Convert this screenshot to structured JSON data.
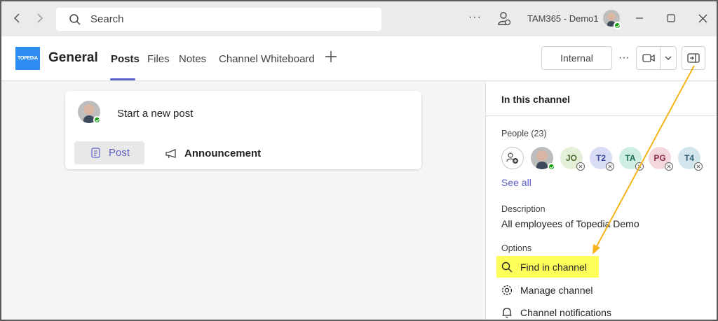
{
  "titlebar": {
    "search_placeholder": "Search",
    "more": "···",
    "account_name": "TAM365 - Demo1"
  },
  "header": {
    "logo_text": "TOPEDIA",
    "channel_name": "General",
    "tabs": [
      {
        "label": "Posts",
        "active": true
      },
      {
        "label": "Files"
      },
      {
        "label": "Notes"
      },
      {
        "label": "Channel Whiteboard"
      }
    ],
    "internal_label": "Internal",
    "more": "···"
  },
  "compose": {
    "prompt": "Start a new post",
    "post_label": "Post",
    "announcement_label": "Announcement"
  },
  "panel": {
    "title": "In this channel",
    "people_label": "People (23)",
    "people": [
      {
        "initials": "JO",
        "bg": "#e4efd8",
        "fg": "#4a6b2e"
      },
      {
        "initials": "T2",
        "bg": "#d8dcf5",
        "fg": "#3c4a9c"
      },
      {
        "initials": "TA",
        "bg": "#cfeee3",
        "fg": "#1f6f54"
      },
      {
        "initials": "PG",
        "bg": "#f4d6dd",
        "fg": "#8f2c45"
      },
      {
        "initials": "T4",
        "bg": "#d3e6ee",
        "fg": "#2b5b70"
      }
    ],
    "see_all": "See all",
    "description_label": "Description",
    "description": "All employees of Topedia Demo",
    "options_label": "Options",
    "options": [
      {
        "label": "Find in channel",
        "icon": "search-icon"
      },
      {
        "label": "Manage channel",
        "icon": "gear-icon"
      },
      {
        "label": "Channel notifications",
        "icon": "bell-icon"
      }
    ]
  },
  "colors": {
    "accent": "#5b5fc7",
    "highlight": "#ffff5c",
    "arrow": "#f5b41a",
    "presence_available": "#13a10e"
  }
}
